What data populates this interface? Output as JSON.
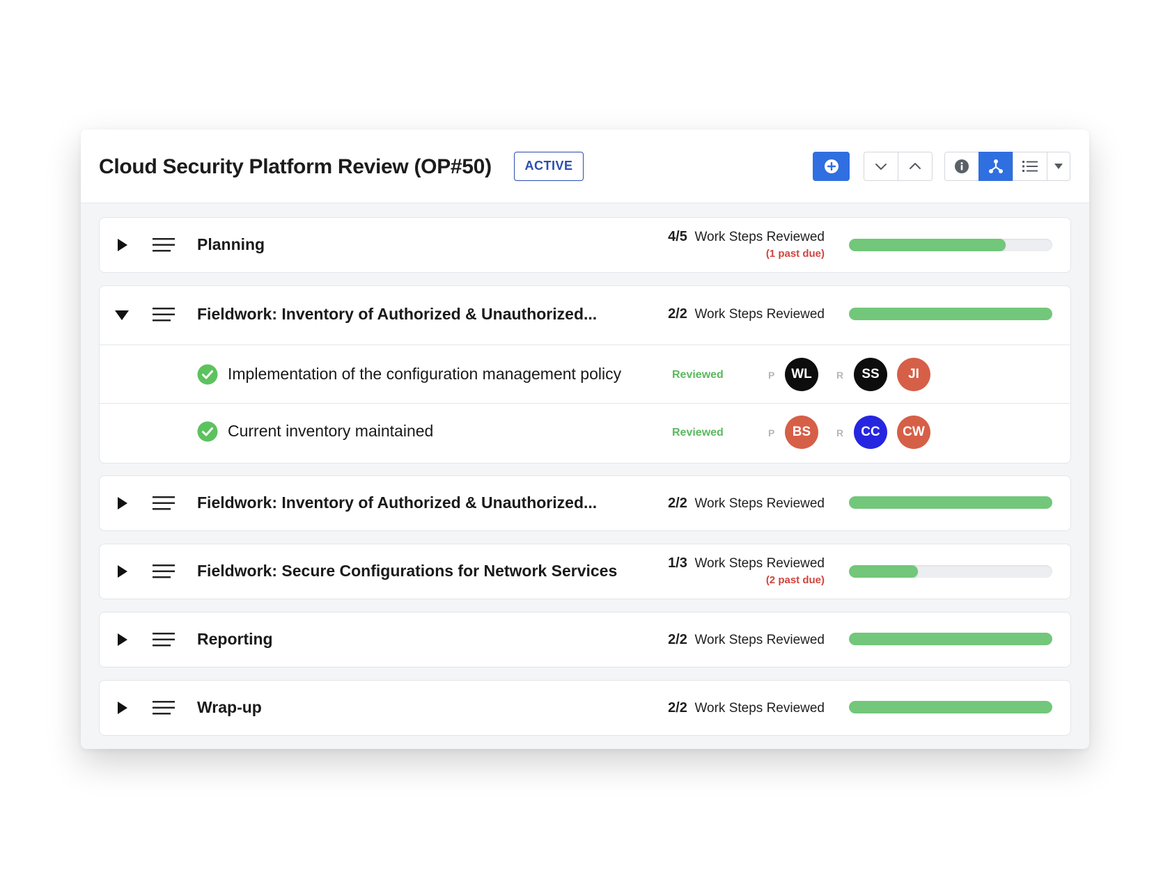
{
  "header": {
    "title": "Cloud Security Platform Review (OP#50)",
    "status": "ACTIVE",
    "toolbar": {
      "add_icon": "plus-circle-icon",
      "collapse_icon": "chevron-down-icon",
      "expand_icon": "chevron-up-icon",
      "info_icon": "info-icon",
      "tree_icon": "hierarchy-icon",
      "list_icon": "list-icon",
      "menu_icon": "caret-down-icon"
    }
  },
  "colors": {
    "accent": "#2f6fe0",
    "progress": "#72c77a",
    "past_due": "#d0453e",
    "reviewed": "#5bb85f"
  },
  "sections": [
    {
      "title": "Planning",
      "count": "4/5",
      "label": "Work Steps Reviewed",
      "past_due": "(1 past due)",
      "progress": 0.77,
      "expanded": false
    },
    {
      "title": "Fieldwork: Inventory of Authorized & Unauthorized...",
      "count": "2/2",
      "label": "Work Steps Reviewed",
      "past_due": "",
      "progress": 1.0,
      "expanded": true,
      "steps": [
        {
          "title": "Implementation of the configuration management policy",
          "status": "Reviewed",
          "preparer_label": "P",
          "reviewer_label": "R",
          "preparers": [
            {
              "initials": "WL",
              "color": "#0d0d0d"
            }
          ],
          "reviewers": [
            {
              "initials": "SS",
              "color": "#0d0d0d"
            },
            {
              "initials": "JI",
              "color": "#d65f48"
            }
          ]
        },
        {
          "title": "Current inventory maintained",
          "status": "Reviewed",
          "preparer_label": "P",
          "reviewer_label": "R",
          "preparers": [
            {
              "initials": "BS",
              "color": "#d65f48"
            }
          ],
          "reviewers": [
            {
              "initials": "CC",
              "color": "#2626e0"
            },
            {
              "initials": "CW",
              "color": "#d65f48"
            }
          ]
        }
      ]
    },
    {
      "title": "Fieldwork: Inventory of Authorized & Unauthorized...",
      "count": "2/2",
      "label": "Work Steps Reviewed",
      "past_due": "",
      "progress": 1.0,
      "expanded": false
    },
    {
      "title": "Fieldwork: Secure Configurations for Network Services",
      "count": "1/3",
      "label": "Work Steps Reviewed",
      "past_due": "(2 past due)",
      "progress": 0.34,
      "expanded": false
    },
    {
      "title": "Reporting",
      "count": "2/2",
      "label": "Work Steps Reviewed",
      "past_due": "",
      "progress": 1.0,
      "expanded": false
    },
    {
      "title": "Wrap-up",
      "count": "2/2",
      "label": "Work Steps Reviewed",
      "past_due": "",
      "progress": 1.0,
      "expanded": false
    }
  ]
}
